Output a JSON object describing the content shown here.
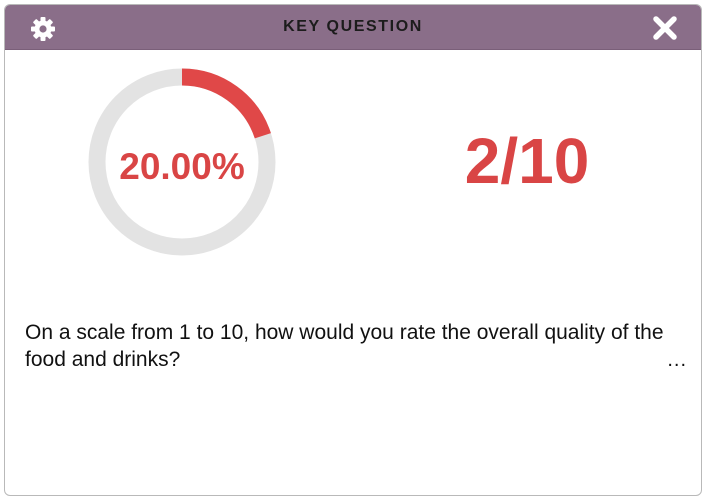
{
  "header": {
    "title": "KEY QUESTION",
    "settings_icon": "gear-icon",
    "close_icon": "close-icon"
  },
  "progress": {
    "percent_label": "20.00%",
    "fraction": 0.2,
    "track_color": "#e3e3e3",
    "fill_color": "#e04848"
  },
  "score": {
    "label": "2/10"
  },
  "question": {
    "text": "On a scale from 1 to 10, how would you rate the overall quality of the food and drinks?",
    "more_label": "..."
  },
  "colors": {
    "header_bg": "#8a6e89",
    "accent": "#d94545"
  }
}
